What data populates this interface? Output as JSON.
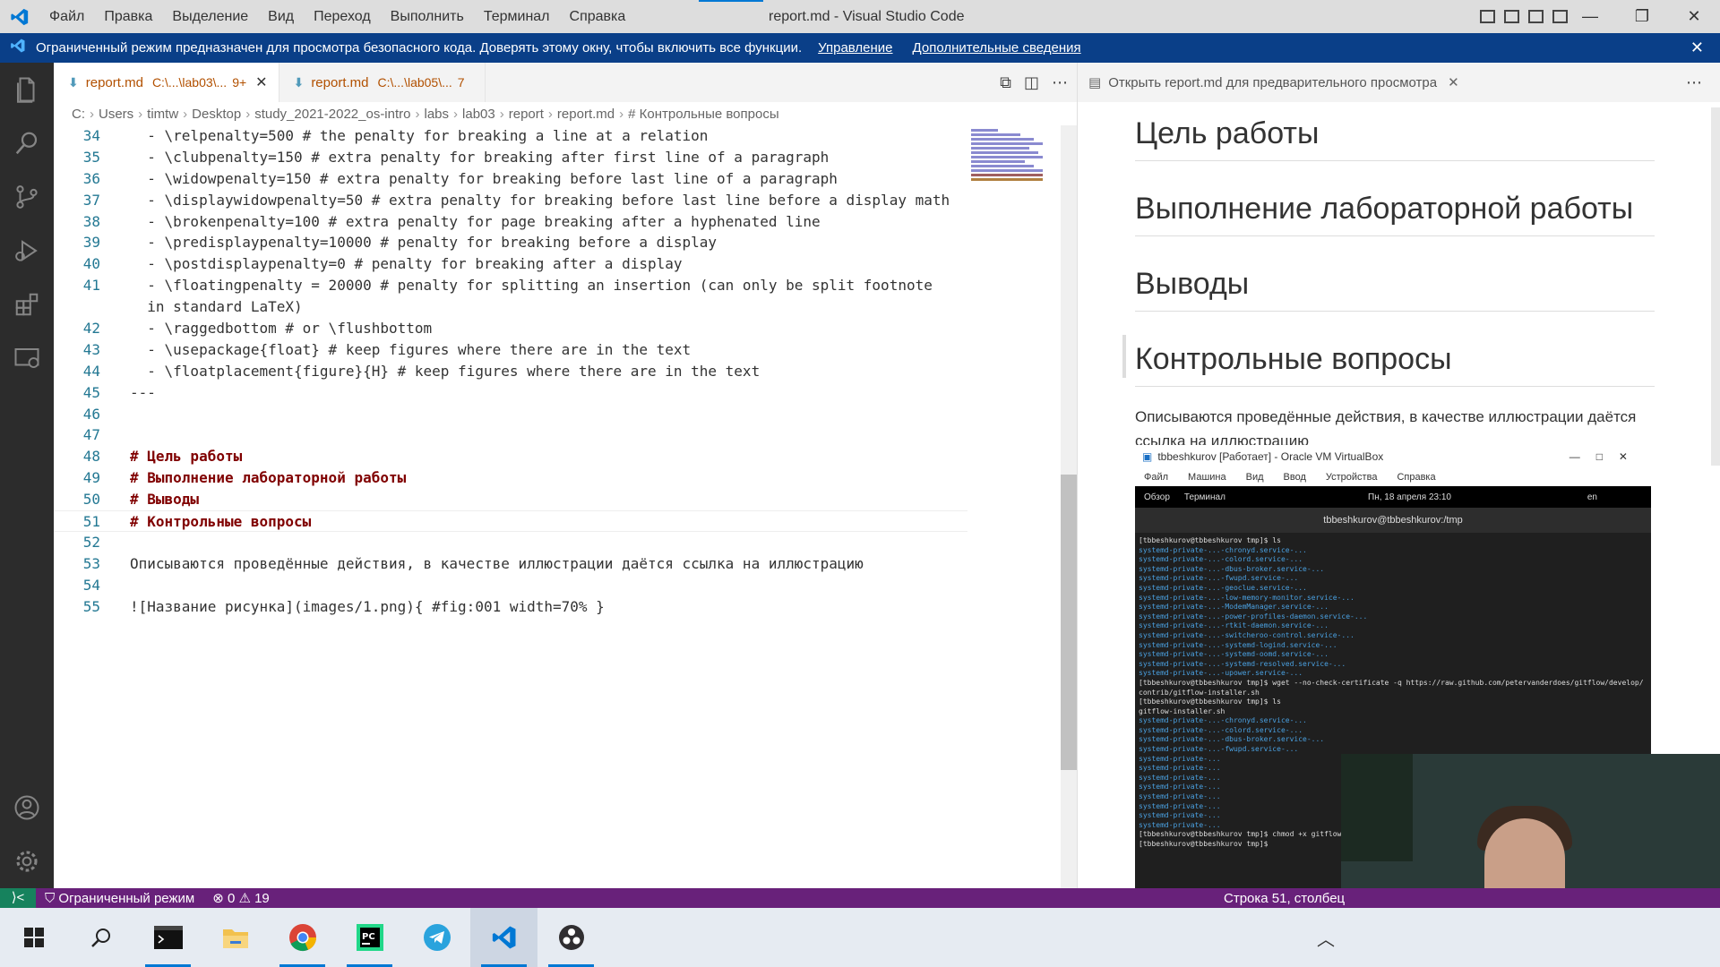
{
  "titlebar": {
    "menu": [
      "Файл",
      "Правка",
      "Выделение",
      "Вид",
      "Переход",
      "Выполнить",
      "Терминал",
      "Справка"
    ],
    "title": "report.md - Visual Studio Code",
    "controls": {
      "minimize": "—",
      "restore": "❐",
      "close": "✕"
    }
  },
  "banner": {
    "message": "Ограниченный режим предназначен для просмотра безопасного кода. Доверять этому окну, чтобы включить все функции.",
    "link_manage": "Управление",
    "link_more": "Дополнительные сведения",
    "close": "✕"
  },
  "tabs": [
    {
      "icon": "⬇",
      "name": "report.md",
      "path": "C:\\...\\lab03\\...",
      "count": "9+",
      "close": "✕"
    },
    {
      "icon": "⬇",
      "name": "report.md",
      "path": "C:\\...\\lab05\\...",
      "count": "7",
      "close": ""
    }
  ],
  "tab_actions": {
    "preview": "⧉",
    "split": "◫",
    "more": "⋯"
  },
  "breadcrumb": [
    "C:",
    "Users",
    "timtw",
    "Desktop",
    "study_2021-2022_os-intro",
    "labs",
    "lab03",
    "report",
    "report.md",
    "# Контрольные вопросы"
  ],
  "code_lines": [
    {
      "n": "34",
      "t": "  - \\relpenalty=500 # the penalty for breaking a line at a relation"
    },
    {
      "n": "35",
      "t": "  - \\clubpenalty=150 # extra penalty for breaking after first line of a paragraph"
    },
    {
      "n": "36",
      "t": "  - \\widowpenalty=150 # extra penalty for breaking before last line of a paragraph"
    },
    {
      "n": "37",
      "t": "  - \\displaywidowpenalty=50 # extra penalty for breaking before last line before a display math"
    },
    {
      "n": "38",
      "t": "  - \\brokenpenalty=100 # extra penalty for page breaking after a hyphenated line"
    },
    {
      "n": "39",
      "t": "  - \\predisplaypenalty=10000 # penalty for breaking before a display"
    },
    {
      "n": "40",
      "t": "  - \\postdisplaypenalty=0 # penalty for breaking after a display"
    },
    {
      "n": "41",
      "t": "  - \\floatingpenalty = 20000 # penalty for splitting an insertion (can only be split footnote"
    },
    {
      "n": "",
      "t": "  in standard LaTeX)"
    },
    {
      "n": "42",
      "t": "  - \\raggedbottom # or \\flushbottom"
    },
    {
      "n": "43",
      "t": "  - \\usepackage{float} # keep figures where there are in the text"
    },
    {
      "n": "44",
      "t": "  - \\floatplacement{figure}{H} # keep figures where there are in the text"
    },
    {
      "n": "45",
      "t": "---"
    },
    {
      "n": "46",
      "t": ""
    },
    {
      "n": "47",
      "t": ""
    },
    {
      "n": "48",
      "t": "# Цель работы",
      "h": true
    },
    {
      "n": "49",
      "t": "# Выполнение лабораторной работы",
      "h": true
    },
    {
      "n": "50",
      "t": "# Выводы",
      "h": true
    },
    {
      "n": "51",
      "t": "# Контрольные вопросы",
      "h": true
    },
    {
      "n": "52",
      "t": ""
    },
    {
      "n": "53",
      "t": "Описываются проведённые действия, в качестве иллюстрации даётся ссылка на иллюстрацию"
    },
    {
      "n": "54",
      "t": ""
    },
    {
      "n": "55",
      "t": "![Название рисунка](images/1.png){ #fig:001 width=70% }"
    }
  ],
  "preview": {
    "tab_label": "Открыть report.md для предварительного просмотра",
    "close": "✕",
    "more": "⋯",
    "headings": [
      "Цель работы",
      "Выполнение лабораторной работы",
      "Выводы",
      "Контрольные вопросы"
    ],
    "paragraph": "Описываются проведённые действия, в качестве иллюстрации даётся ссылка на иллюстрацию",
    "vm": {
      "title": "tbbeshkurov [Работает] - Oracle VM VirtualBox",
      "menu": [
        "Файл",
        "Машина",
        "Вид",
        "Ввод",
        "Устройства",
        "Справка"
      ],
      "overview": "Обзор",
      "terminal": "Терминал",
      "date": "Пн, 18 апреля 23:10",
      "lang": "en",
      "term_title": "tbbeshkurov@tbbeshkurov:/tmp",
      "lines": [
        "[tbbeshkurov@tbbeshkurov tmp]$ ls",
        "systemd-private-...-chronyd.service-...",
        "systemd-private-...-colord.service-...",
        "systemd-private-...-dbus-broker.service-...",
        "systemd-private-...-fwupd.service-...",
        "systemd-private-...-geoclue.service-...",
        "systemd-private-...-low-memory-monitor.service-...",
        "systemd-private-...-ModemManager.service-...",
        "systemd-private-...-power-profiles-daemon.service-...",
        "systemd-private-...-rtkit-daemon.service-...",
        "systemd-private-...-switcheroo-control.service-...",
        "systemd-private-...-systemd-logind.service-...",
        "systemd-private-...-systemd-oomd.service-...",
        "systemd-private-...-systemd-resolved.service-...",
        "systemd-private-...-upower.service-...",
        "[tbbeshkurov@tbbeshkurov tmp]$ wget --no-check-certificate -q https://raw.github.com/petervanderdoes/gitflow/develop/",
        "contrib/gitflow-installer.sh",
        "[tbbeshkurov@tbbeshkurov tmp]$ ls",
        "gitflow-installer.sh",
        "systemd-private-...-chronyd.service-...",
        "systemd-private-...-colord.service-...",
        "systemd-private-...-dbus-broker.service-...",
        "systemd-private-...-fwupd.service-...",
        "systemd-private-...",
        "systemd-private-...",
        "systemd-private-...",
        "systemd-private-...",
        "systemd-private-...",
        "systemd-private-...",
        "systemd-private-...",
        "systemd-private-...",
        "[tbbeshkurov@tbbeshkurov tmp]$ chmod +x gitflow-",
        "[tbbeshkurov@tbbeshkurov tmp]$"
      ]
    }
  },
  "statusbar": {
    "remote": "⟩<",
    "restricted": "Ограниченный режим",
    "errors": "⊗ 0",
    "warnings": "⚠ 19",
    "position": "Строка 51, столбец"
  },
  "colors": {
    "banner_bg": "#0a3f88",
    "statusbar_bg": "#68217a",
    "activity_bg": "#2c2c2c",
    "accent": "#0078d4"
  }
}
